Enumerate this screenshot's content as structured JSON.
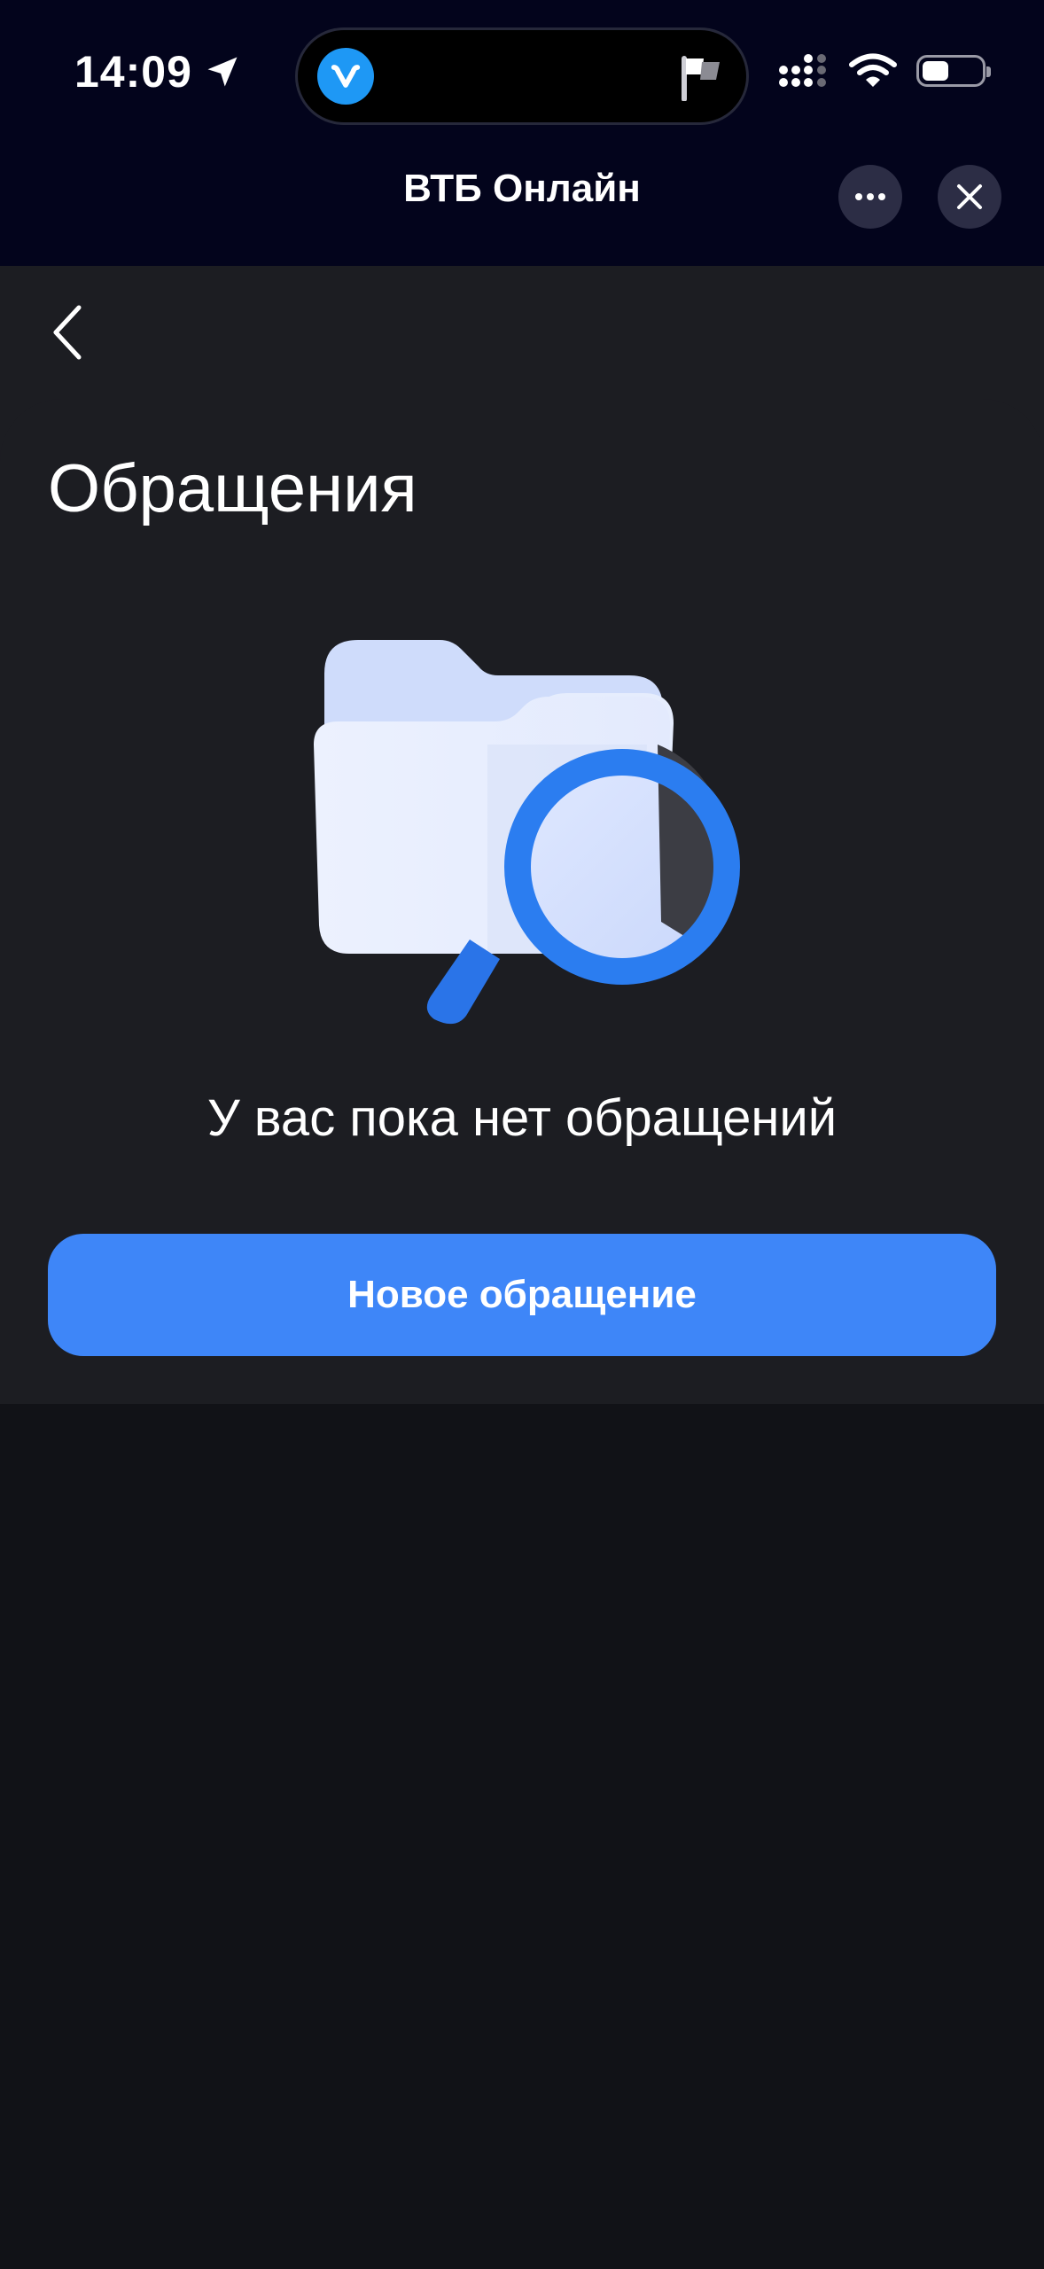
{
  "status_bar": {
    "time": "14:09",
    "battery_level": 0.45
  },
  "header": {
    "title": "ВТБ Онлайн"
  },
  "page": {
    "title": "Обращения",
    "empty_message": "У вас пока нет обращений",
    "new_request_button": "Новое обращение"
  },
  "icons": {
    "location": "location-arrow-icon",
    "app": "vk-app-icon",
    "flag": "flag-icon",
    "signal": "cellular-signal-icon",
    "wifi": "wifi-icon",
    "battery": "battery-icon",
    "more": "more-dots-icon",
    "close": "close-icon",
    "back": "chevron-left-icon",
    "illustration": "folder-magnifier-icon"
  },
  "colors": {
    "header_bg": "#03041c",
    "surface": "#1c1d22",
    "background": "#111217",
    "accent": "#3e86f8"
  }
}
